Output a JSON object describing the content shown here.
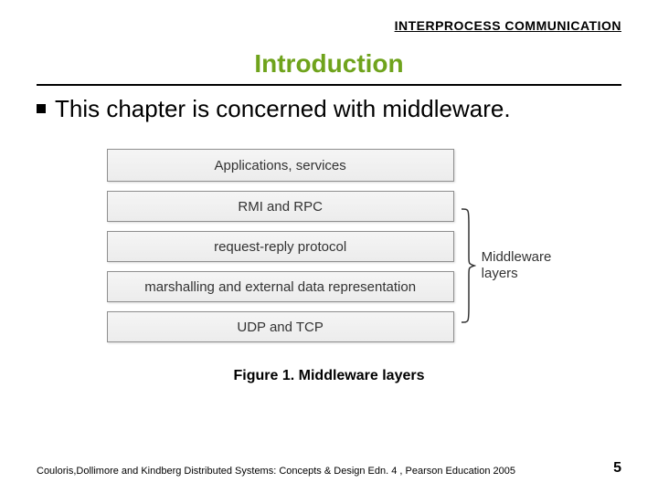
{
  "header": "INTERPROCESS COMMUNICATION",
  "title": "Introduction",
  "bullet": "This chapter is concerned with middleware.",
  "layers": {
    "l0": "Applications, services",
    "l1": "RMI and RPC",
    "l2": "request-reply protocol",
    "l3": "marshalling and external data representation",
    "l4": "UDP and TCP"
  },
  "brace_label_line1": "Middleware",
  "brace_label_line2": "layers",
  "caption": "Figure 1. Middleware layers",
  "citation": "Couloris,Dollimore and Kindberg  Distributed Systems: Concepts & Design  Edn. 4 , Pearson Education 2005",
  "page_number": "5"
}
